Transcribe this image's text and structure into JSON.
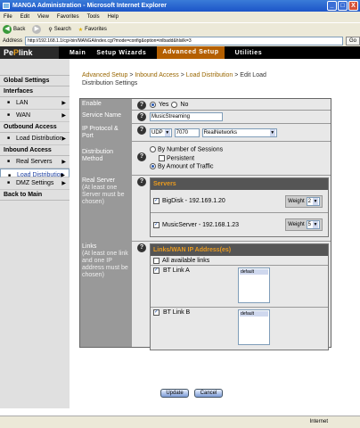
{
  "window": {
    "title": "MANGA Administration - Microsoft Internet Explorer",
    "min": "_",
    "max": "□",
    "close": "X"
  },
  "menu": [
    "File",
    "Edit",
    "View",
    "Favorites",
    "Tools",
    "Help"
  ],
  "toolbar": {
    "back": "Back",
    "search": "Search",
    "favorites": "Favorites"
  },
  "address": {
    "label": "Address",
    "url": "http://192.168.1.1/cgi-bin/MANGA/index.cgi?mode=config&option=inlbadd&hlsilk=3",
    "go": "Go"
  },
  "logo": {
    "pre": "Pe",
    "mid": "P",
    "post": "link"
  },
  "nav": [
    "Main",
    "Setup Wizards",
    "Advanced Setup",
    "Utilities"
  ],
  "sidebar": {
    "global": "Global Settings",
    "interfaces": "Interfaces",
    "lan": "LAN",
    "wan": "WAN",
    "outbound": "Outbound Access",
    "outbound_lb": "Load Distribution",
    "inbound": "Inbound Access",
    "real_servers": "Real Servers",
    "inbound_lb": "Load Distribution",
    "dmz": "DMZ Settings",
    "back": "Back to Main"
  },
  "breadcrumb": {
    "a": "Advanced Setup",
    "b": "Inbound Access",
    "c": "Load Distribution",
    "d": "Edit Load Distribution Settings"
  },
  "form": {
    "enable": {
      "label": "Enable",
      "yes": "Yes",
      "no": "No"
    },
    "service": {
      "label": "Service Name",
      "value": "MusicStreaming"
    },
    "protocol": {
      "label": "IP Protocol & Port",
      "proto": "UDP",
      "port": "7070",
      "app": "RealNetworks"
    },
    "method": {
      "label": "Distribution Method",
      "opt1": "By Number of Sessions",
      "persistent": "Persistent",
      "opt2": "By Amount of Traffic"
    },
    "real": {
      "label": "Real Server",
      "note": "(At least one Server must be chosen)",
      "header": "Servers",
      "servers": [
        {
          "name": "BigDisk - 192.169.1.20",
          "weight_label": "Weight",
          "weight": "2"
        },
        {
          "name": "MusicServer - 192.168.1.23",
          "weight_label": "Weight",
          "weight": "5"
        }
      ]
    },
    "links": {
      "label": "Links",
      "note": "(At least one link and one IP address must be chosen)",
      "header": "Links/WAN IP Address(es)",
      "all": "All available links",
      "items": [
        {
          "name": "BT Link A",
          "ip": "default"
        },
        {
          "name": "BT Link B",
          "ip": "default"
        }
      ]
    }
  },
  "buttons": {
    "update": "Update",
    "cancel": "Cancel"
  },
  "status": {
    "zone": "Internet"
  }
}
